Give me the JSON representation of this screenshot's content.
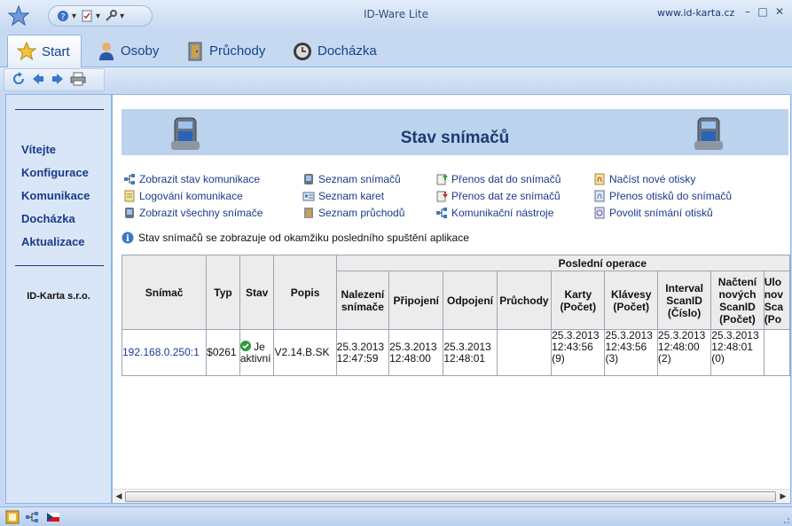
{
  "window": {
    "title": "ID-Ware Lite",
    "website": "www.id-karta.cz",
    "minimize_glyph": "–",
    "maximize_glyph": "□",
    "close_glyph": "✕"
  },
  "tabs": [
    {
      "label": "Start",
      "icon": "star-icon",
      "active": true
    },
    {
      "label": "Osoby",
      "icon": "person-icon"
    },
    {
      "label": "Průchody",
      "icon": "door-icon"
    },
    {
      "label": "Docházka",
      "icon": "clock-icon"
    }
  ],
  "sidebar": {
    "links": [
      "Vítejte",
      "Konfigurace",
      "Komunikace",
      "Docházka",
      "Aktualizace"
    ],
    "company": "ID-Karta s.r.o."
  },
  "main": {
    "title": "Stav snímačů",
    "links": {
      "col1": [
        "Zobrazit stav komunikace",
        "Logování komunikace",
        "Zobrazit všechny snímače"
      ],
      "col2": [
        "Seznam snímačů",
        "Seznam karet",
        "Seznam průchodů"
      ],
      "col3": [
        "Přenos dat do snímačů",
        "Přenos dat ze snímačů",
        "Komunikační nástroje"
      ],
      "col4": [
        "Načíst nové otisky",
        "Přenos otisků do snímačů",
        "Povolit snímání otisků"
      ]
    },
    "info_text": "Stav snímačů se zobrazuje od okamžiku posledního spuštění aplikace"
  },
  "table": {
    "group_header": "Poslední operace",
    "headers": {
      "snimac": "Snímač",
      "typ": "Typ",
      "stav": "Stav",
      "popis": "Popis",
      "nalezeni": [
        "Nalezení",
        "snímače"
      ],
      "pripojeni": "Připojení",
      "odpojeni": "Odpojení",
      "pruchody": "Průchody",
      "karty": [
        "Karty",
        "(Počet)"
      ],
      "klavesy": [
        "Klávesy",
        "(Počet)"
      ],
      "interval": [
        "Interval",
        "ScanID",
        "(Číslo)"
      ],
      "nacteni": [
        "Načtení",
        "nových",
        "ScanID",
        "(Počet)"
      ],
      "ulozeni": [
        "Ulo",
        "nov",
        "Sca",
        "(Po"
      ]
    },
    "row": {
      "snimac": "192.168.0.250:1",
      "typ": "$0261",
      "stav": [
        "Je",
        "aktivní"
      ],
      "popis": "V2.14.B.SK",
      "nalezeni": [
        "25.3.2013",
        "12:47:59"
      ],
      "pripojeni": [
        "25.3.2013",
        "12:48:00"
      ],
      "odpojeni": [
        "25.3.2013",
        "12:48:01"
      ],
      "pruchody": "",
      "karty": [
        "25.3.2013",
        "12:43:56",
        "(9)"
      ],
      "klavesy": [
        "25.3.2013",
        "12:43:56",
        "(3)"
      ],
      "interval": [
        "25.3.2013",
        "12:48:00",
        "(2)"
      ],
      "nacteni": [
        "25.3.2013",
        "12:48:01",
        "(0)"
      ],
      "ulozeni": ""
    }
  }
}
